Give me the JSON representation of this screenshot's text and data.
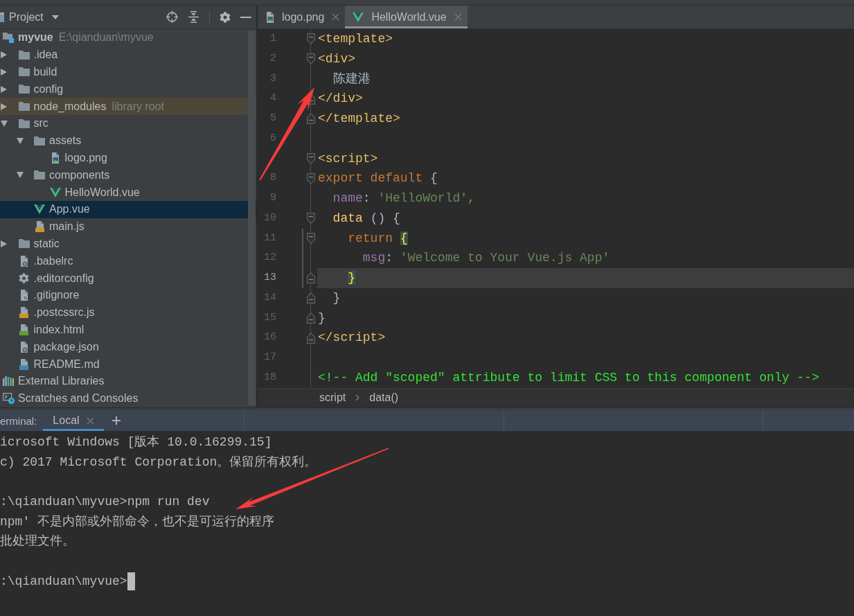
{
  "project_panel": {
    "title": "Project",
    "tree": [
      {
        "label": "myvue",
        "hint": "E:\\qianduan\\myvue",
        "kind": "module",
        "selected": false,
        "children": [
          {
            "label": ".idea",
            "kind": "folder",
            "expanded": false,
            "selected": false
          },
          {
            "label": "build",
            "kind": "folder",
            "expanded": false,
            "selected": false
          },
          {
            "label": "config",
            "kind": "folder",
            "expanded": false,
            "selected": false
          },
          {
            "label": "node_modules",
            "hint": "library root",
            "kind": "library",
            "expanded": false,
            "selected": false
          },
          {
            "label": "src",
            "kind": "folder",
            "expanded": true,
            "selected": false,
            "children": [
              {
                "label": "assets",
                "kind": "folder",
                "expanded": true,
                "selected": false,
                "children": [
                  {
                    "label": "logo.png",
                    "kind": "image",
                    "selected": false
                  }
                ]
              },
              {
                "label": "components",
                "kind": "folder",
                "expanded": true,
                "selected": false,
                "children": [
                  {
                    "label": "HelloWorld.vue",
                    "kind": "vue",
                    "selected": false
                  }
                ]
              },
              {
                "label": "App.vue",
                "kind": "vue",
                "selected": true
              },
              {
                "label": "main.js",
                "kind": "script",
                "selected": false
              }
            ]
          },
          {
            "label": "static",
            "kind": "folder",
            "expanded": false,
            "selected": false
          },
          {
            "label": ".babelrc",
            "kind": "json",
            "selected": false
          },
          {
            "label": ".editorconfig",
            "kind": "settings",
            "selected": false
          },
          {
            "label": ".gitignore",
            "kind": "ignore",
            "selected": false
          },
          {
            "label": ".postcssrc.js",
            "kind": "script",
            "selected": false
          },
          {
            "label": "index.html",
            "kind": "html",
            "selected": false
          },
          {
            "label": "package.json",
            "kind": "json",
            "selected": false
          },
          {
            "label": "README.md",
            "kind": "markdown",
            "selected": false
          }
        ]
      },
      {
        "label": "External Libraries",
        "kind": "libraries",
        "selected": false
      },
      {
        "label": "Scratches and Consoles",
        "kind": "scratches",
        "selected": false
      }
    ]
  },
  "editor": {
    "tabs": [
      {
        "label": "logo.png",
        "kind": "image",
        "selected": false
      },
      {
        "label": "HelloWorld.vue",
        "kind": "vue",
        "selected": true
      }
    ],
    "lines": [
      {
        "number": "1",
        "kind": "open",
        "current": false,
        "modified": false,
        "tokens": [
          {
            "text": "<template>",
            "kind": "tag"
          }
        ]
      },
      {
        "number": "2",
        "kind": "open",
        "current": false,
        "modified": false,
        "tokens": [
          {
            "text": "<div>",
            "kind": "tag"
          }
        ]
      },
      {
        "number": "3",
        "kind": "plain",
        "current": false,
        "modified": false,
        "tokens": [
          {
            "text": "  陈建港",
            "kind": "plain"
          }
        ]
      },
      {
        "number": "4",
        "kind": "close",
        "current": false,
        "modified": false,
        "tokens": [
          {
            "text": "</div>",
            "kind": "tag"
          }
        ]
      },
      {
        "number": "5",
        "kind": "close",
        "current": false,
        "modified": false,
        "tokens": [
          {
            "text": "</template>",
            "kind": "tag"
          }
        ]
      },
      {
        "number": "6",
        "kind": "plain",
        "current": false,
        "modified": false
      },
      {
        "kind": "open",
        "current": false,
        "modified": false,
        "tokens": [
          {
            "text": "<script>",
            "kind": "tag"
          }
        ]
      },
      {
        "number": "8",
        "kind": "open",
        "current": false,
        "modified": false,
        "tokens": [
          {
            "text": "export default",
            "kind": "keyword"
          },
          {
            "text": " {",
            "kind": "plain"
          }
        ]
      },
      {
        "number": "9",
        "kind": "plain",
        "current": false,
        "modified": false,
        "tokens": [
          {
            "text": "  name",
            "kind": "property"
          },
          {
            "text": ": ",
            "kind": "plain"
          },
          {
            "text": "'HelloWorld'",
            "kind": "string"
          },
          {
            "text": ",",
            "kind": "keyword"
          }
        ]
      },
      {
        "number": "10",
        "kind": "open",
        "current": false,
        "modified": false,
        "tokens": [
          {
            "text": "  data",
            "kind": "function"
          },
          {
            "text": " () {",
            "kind": "plain"
          }
        ]
      },
      {
        "number": "11",
        "kind": "open",
        "current": false,
        "modified": true,
        "tokens": [
          {
            "text": "    return ",
            "kind": "keyword"
          },
          {
            "text": "{",
            "kind": "brace"
          }
        ]
      },
      {
        "number": "12",
        "kind": "plain",
        "current": false,
        "modified": true,
        "tokens": [
          {
            "text": "      msg",
            "kind": "property"
          },
          {
            "text": ": ",
            "kind": "plain"
          },
          {
            "text": "'Welcome to Your Vue.js App'",
            "kind": "string"
          }
        ]
      },
      {
        "number": "13",
        "kind": "close",
        "current": true,
        "modified": true,
        "tokens": [
          {
            "text": "    }",
            "kind": "brace"
          }
        ]
      },
      {
        "number": "14",
        "kind": "close",
        "current": false,
        "modified": false,
        "tokens": [
          {
            "text": "  }",
            "kind": "plain"
          }
        ]
      },
      {
        "number": "15",
        "kind": "close",
        "current": false,
        "modified": false,
        "tokens": [
          {
            "text": "}",
            "kind": "plain"
          }
        ]
      },
      {
        "number": "16",
        "kind": "close",
        "current": false,
        "modified": false,
        "tokens": [
          {
            "text": "</script>",
            "kind": "tag"
          }
        ]
      },
      {
        "number": "17",
        "kind": "plain",
        "current": false,
        "modified": false
      },
      {
        "number": "18",
        "kind": "plain",
        "current": false,
        "modified": false,
        "tokens": [
          {
            "text": "<!-- Add \"scoped\" attribute to limit CSS to this component only -->",
            "kind": "comment"
          }
        ]
      }
    ],
    "breadcrumb": [
      "script",
      "data()"
    ]
  },
  "terminal": {
    "title": "erminal:",
    "tabs": [
      {
        "label": "Local",
        "selected": true
      }
    ],
    "blocks": [
      [
        "icrosoft Windows [版本 10.0.16299.15]",
        "c) 2017 Microsoft Corporation。保留所有权利。"
      ],
      [
        ":\\qianduan\\myvue>npm run dev",
        "npm' 不是内部或外部命令，也不是可运行的程序",
        "批处理文件。"
      ],
      [
        ":\\qianduan\\myvue>"
      ]
    ],
    "cursor": true
  },
  "annotations": [
    {
      "kind": "arrow"
    },
    {
      "kind": "arrow"
    }
  ]
}
